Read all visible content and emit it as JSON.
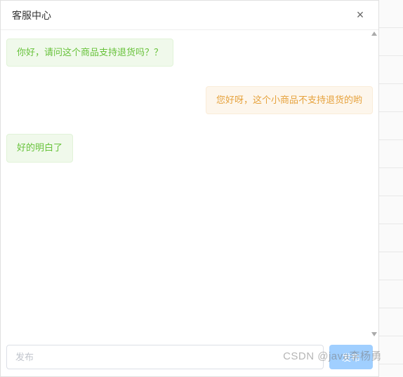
{
  "header": {
    "title": "客服中心",
    "close_label": "×"
  },
  "messages": [
    {
      "side": "left",
      "role": "user",
      "text": "你好，请问这个商品支持退货吗？？"
    },
    {
      "side": "right",
      "role": "service",
      "text": "您好呀，这个小商品不支持退货的哟"
    },
    {
      "side": "left",
      "role": "user",
      "text": "好的明白了"
    }
  ],
  "input": {
    "placeholder": "发布",
    "send_label": "发布"
  },
  "watermark": "CSDN @java李杨勇"
}
